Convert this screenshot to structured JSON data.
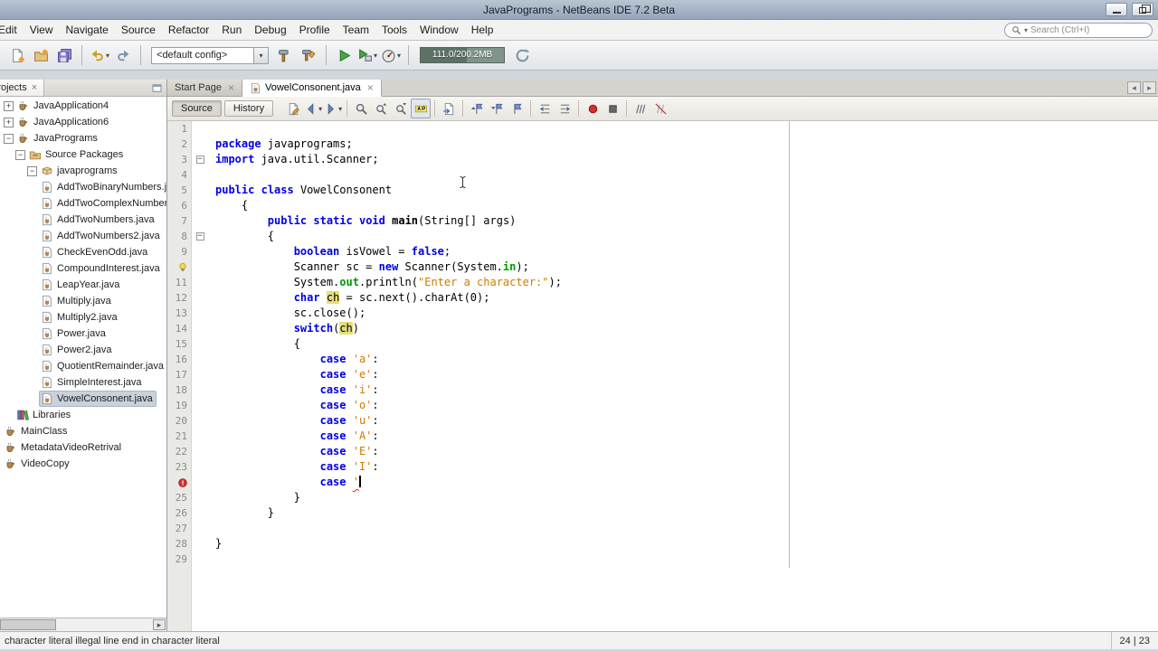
{
  "window": {
    "title": "JavaPrograms - NetBeans IDE 7.2 Beta"
  },
  "menu": {
    "items": [
      "Edit",
      "View",
      "Navigate",
      "Source",
      "Refactor",
      "Run",
      "Debug",
      "Profile",
      "Team",
      "Tools",
      "Window",
      "Help"
    ],
    "search_placeholder": "Search (Ctrl+I)"
  },
  "toolbar": {
    "groups": [
      [
        {
          "name": "new-file"
        },
        {
          "name": "new-project"
        },
        {
          "name": "save-all"
        }
      ],
      [
        {
          "name": "undo",
          "dropdown": true
        },
        {
          "name": "redo"
        }
      ],
      [
        {
          "name": "config-select",
          "type": "select",
          "value": "<default config>"
        },
        {
          "name": "build"
        },
        {
          "name": "clean-build"
        }
      ],
      [
        {
          "name": "run"
        },
        {
          "name": "debug",
          "dropdown": true
        },
        {
          "name": "profile",
          "dropdown": true
        }
      ],
      [
        {
          "name": "memory-meter",
          "type": "memory",
          "value": "111.0/200.2MB"
        },
        {
          "name": "run-gc"
        }
      ]
    ]
  },
  "projects_panel": {
    "tab_label": "Projects",
    "tree": [
      {
        "label": "JavaApplication4",
        "level": 0,
        "icon": "project",
        "expander": "+"
      },
      {
        "label": "JavaApplication6",
        "level": 0,
        "icon": "project",
        "expander": "+"
      },
      {
        "label": "JavaPrograms",
        "level": 0,
        "icon": "project",
        "expander": "-"
      },
      {
        "label": "Source Packages",
        "level": 1,
        "icon": "package-root",
        "expander": "-"
      },
      {
        "label": "javaprograms",
        "level": 2,
        "icon": "package",
        "expander": "-"
      },
      {
        "label": "AddTwoBinaryNumbers.java",
        "level": 3,
        "icon": "java"
      },
      {
        "label": "AddTwoComplexNumbers.java",
        "level": 3,
        "icon": "java"
      },
      {
        "label": "AddTwoNumbers.java",
        "level": 3,
        "icon": "java"
      },
      {
        "label": "AddTwoNumbers2.java",
        "level": 3,
        "icon": "java"
      },
      {
        "label": "CheckEvenOdd.java",
        "level": 3,
        "icon": "java"
      },
      {
        "label": "CompoundInterest.java",
        "level": 3,
        "icon": "java"
      },
      {
        "label": "LeapYear.java",
        "level": 3,
        "icon": "java"
      },
      {
        "label": "Multiply.java",
        "level": 3,
        "icon": "java"
      },
      {
        "label": "Multiply2.java",
        "level": 3,
        "icon": "java"
      },
      {
        "label": "Power.java",
        "level": 3,
        "icon": "java"
      },
      {
        "label": "Power2.java",
        "level": 3,
        "icon": "java"
      },
      {
        "label": "QuotientRemainder.java",
        "level": 3,
        "icon": "java"
      },
      {
        "label": "SimpleInterest.java",
        "level": 3,
        "icon": "java"
      },
      {
        "label": "VowelConsonent.java",
        "level": 3,
        "icon": "java",
        "selected": true
      },
      {
        "label": "Libraries",
        "level": 1,
        "icon": "libraries"
      },
      {
        "label": "MainClass",
        "level": 0,
        "icon": "project"
      },
      {
        "label": "MetadataVideoRetrival",
        "level": 0,
        "icon": "project"
      },
      {
        "label": "VideoCopy",
        "level": 0,
        "icon": "project"
      }
    ]
  },
  "editor": {
    "tabs": [
      {
        "label": "Start Page",
        "active": false
      },
      {
        "label": "VowelConsonent.java",
        "icon": "java",
        "active": true
      }
    ],
    "toolbar": {
      "source_label": "Source",
      "history_label": "History",
      "icon_groups": [
        [
          {
            "name": "last-edit"
          },
          {
            "name": "back",
            "dropdown": true
          },
          {
            "name": "forward",
            "dropdown": true
          }
        ],
        [
          {
            "name": "find-selection"
          },
          {
            "name": "find-previous"
          },
          {
            "name": "find-next"
          },
          {
            "name": "highlight",
            "toggled": true
          }
        ],
        [
          {
            "name": "select-in-projects"
          }
        ],
        [
          {
            "name": "previous-bookmark"
          },
          {
            "name": "next-bookmark"
          },
          {
            "name": "toggle-bookmark"
          }
        ],
        [
          {
            "name": "shift-line-left"
          },
          {
            "name": "shift-line-right"
          }
        ],
        [
          {
            "name": "start-macro"
          },
          {
            "name": "stop-macro"
          }
        ],
        [
          {
            "name": "comment"
          },
          {
            "name": "uncomment"
          }
        ]
      ]
    },
    "lines": [
      {
        "n": 1,
        "segs": []
      },
      {
        "n": 2,
        "segs": [
          [
            "kw",
            "package"
          ],
          [
            "pl",
            " javaprograms;"
          ]
        ]
      },
      {
        "n": 3,
        "fold": true,
        "segs": [
          [
            "kw",
            "import"
          ],
          [
            "pl",
            " java.util.Scanner;"
          ]
        ]
      },
      {
        "n": 4,
        "segs": []
      },
      {
        "n": 5,
        "segs": [
          [
            "kw",
            "public"
          ],
          [
            "pl",
            " "
          ],
          [
            "kw",
            "class"
          ],
          [
            "pl",
            " VowelConsonent"
          ]
        ]
      },
      {
        "n": 6,
        "segs": [
          [
            "pl",
            "    {"
          ]
        ]
      },
      {
        "n": 7,
        "segs": [
          [
            "pl",
            "        "
          ],
          [
            "kw",
            "public"
          ],
          [
            "pl",
            " "
          ],
          [
            "kw",
            "static"
          ],
          [
            "pl",
            " "
          ],
          [
            "kw",
            "void"
          ],
          [
            "pl",
            " "
          ],
          [
            "mth",
            "main"
          ],
          [
            "pl",
            "(String[] args)"
          ]
        ]
      },
      {
        "n": 8,
        "fold": true,
        "segs": [
          [
            "pl",
            "        {"
          ]
        ]
      },
      {
        "n": 9,
        "segs": [
          [
            "pl",
            "            "
          ],
          [
            "kw",
            "boolean"
          ],
          [
            "pl",
            " isVowel = "
          ],
          [
            "kw",
            "false"
          ],
          [
            "pl",
            ";"
          ]
        ]
      },
      {
        "n": 10,
        "marker": "warning",
        "segs": [
          [
            "pl",
            "            Scanner sc = "
          ],
          [
            "kw",
            "new"
          ],
          [
            "pl",
            " Scanner(System."
          ],
          [
            "fld",
            "in"
          ],
          [
            "pl",
            ");"
          ]
        ]
      },
      {
        "n": 11,
        "segs": [
          [
            "pl",
            "            System."
          ],
          [
            "fld",
            "out"
          ],
          [
            "pl",
            ".println("
          ],
          [
            "str",
            "\"Enter a character:\""
          ],
          [
            "pl",
            ");"
          ]
        ]
      },
      {
        "n": 12,
        "segs": [
          [
            "pl",
            "            "
          ],
          [
            "kw",
            "char"
          ],
          [
            "pl",
            " "
          ],
          [
            "occ",
            "ch"
          ],
          [
            "pl",
            " = sc.next().charAt(0);"
          ]
        ]
      },
      {
        "n": 13,
        "segs": [
          [
            "pl",
            "            sc.close();"
          ]
        ]
      },
      {
        "n": 14,
        "segs": [
          [
            "pl",
            "            "
          ],
          [
            "kw",
            "switch"
          ],
          [
            "pl",
            "("
          ],
          [
            "occ",
            "ch"
          ],
          [
            "pl",
            ")"
          ]
        ]
      },
      {
        "n": 15,
        "segs": [
          [
            "pl",
            "            {"
          ]
        ]
      },
      {
        "n": 16,
        "segs": [
          [
            "pl",
            "                "
          ],
          [
            "kw",
            "case"
          ],
          [
            "pl",
            " "
          ],
          [
            "str",
            "'a'"
          ],
          [
            "pl",
            ":"
          ]
        ]
      },
      {
        "n": 17,
        "segs": [
          [
            "pl",
            "                "
          ],
          [
            "kw",
            "case"
          ],
          [
            "pl",
            " "
          ],
          [
            "str",
            "'e'"
          ],
          [
            "pl",
            ":"
          ]
        ]
      },
      {
        "n": 18,
        "segs": [
          [
            "pl",
            "                "
          ],
          [
            "kw",
            "case"
          ],
          [
            "pl",
            " "
          ],
          [
            "str",
            "'i'"
          ],
          [
            "pl",
            ":"
          ]
        ]
      },
      {
        "n": 19,
        "segs": [
          [
            "pl",
            "                "
          ],
          [
            "kw",
            "case"
          ],
          [
            "pl",
            " "
          ],
          [
            "str",
            "'o'"
          ],
          [
            "pl",
            ":"
          ]
        ]
      },
      {
        "n": 20,
        "segs": [
          [
            "pl",
            "                "
          ],
          [
            "kw",
            "case"
          ],
          [
            "pl",
            " "
          ],
          [
            "str",
            "'u'"
          ],
          [
            "pl",
            ":"
          ]
        ]
      },
      {
        "n": 21,
        "segs": [
          [
            "pl",
            "                "
          ],
          [
            "kw",
            "case"
          ],
          [
            "pl",
            " "
          ],
          [
            "str",
            "'A'"
          ],
          [
            "pl",
            ":"
          ]
        ]
      },
      {
        "n": 22,
        "segs": [
          [
            "pl",
            "                "
          ],
          [
            "kw",
            "case"
          ],
          [
            "pl",
            " "
          ],
          [
            "str",
            "'E'"
          ],
          [
            "pl",
            ":"
          ]
        ]
      },
      {
        "n": 23,
        "segs": [
          [
            "pl",
            "                "
          ],
          [
            "kw",
            "case"
          ],
          [
            "pl",
            " "
          ],
          [
            "str",
            "'I'"
          ],
          [
            "pl",
            ":"
          ]
        ]
      },
      {
        "n": 24,
        "marker": "error",
        "caret": true,
        "segs": [
          [
            "pl",
            "                "
          ],
          [
            "kw",
            "case"
          ],
          [
            "pl",
            " "
          ],
          [
            "strerr",
            "'"
          ]
        ]
      },
      {
        "n": 25,
        "segs": [
          [
            "pl",
            "            }"
          ]
        ]
      },
      {
        "n": 26,
        "segs": [
          [
            "pl",
            "        }"
          ]
        ]
      },
      {
        "n": 27,
        "segs": []
      },
      {
        "n": 28,
        "segs": [
          [
            "pl",
            "}"
          ]
        ]
      },
      {
        "n": 29,
        "segs": []
      }
    ]
  },
  "status": {
    "message": "character literal  illegal line end in character literal",
    "position": "24 | 23"
  }
}
